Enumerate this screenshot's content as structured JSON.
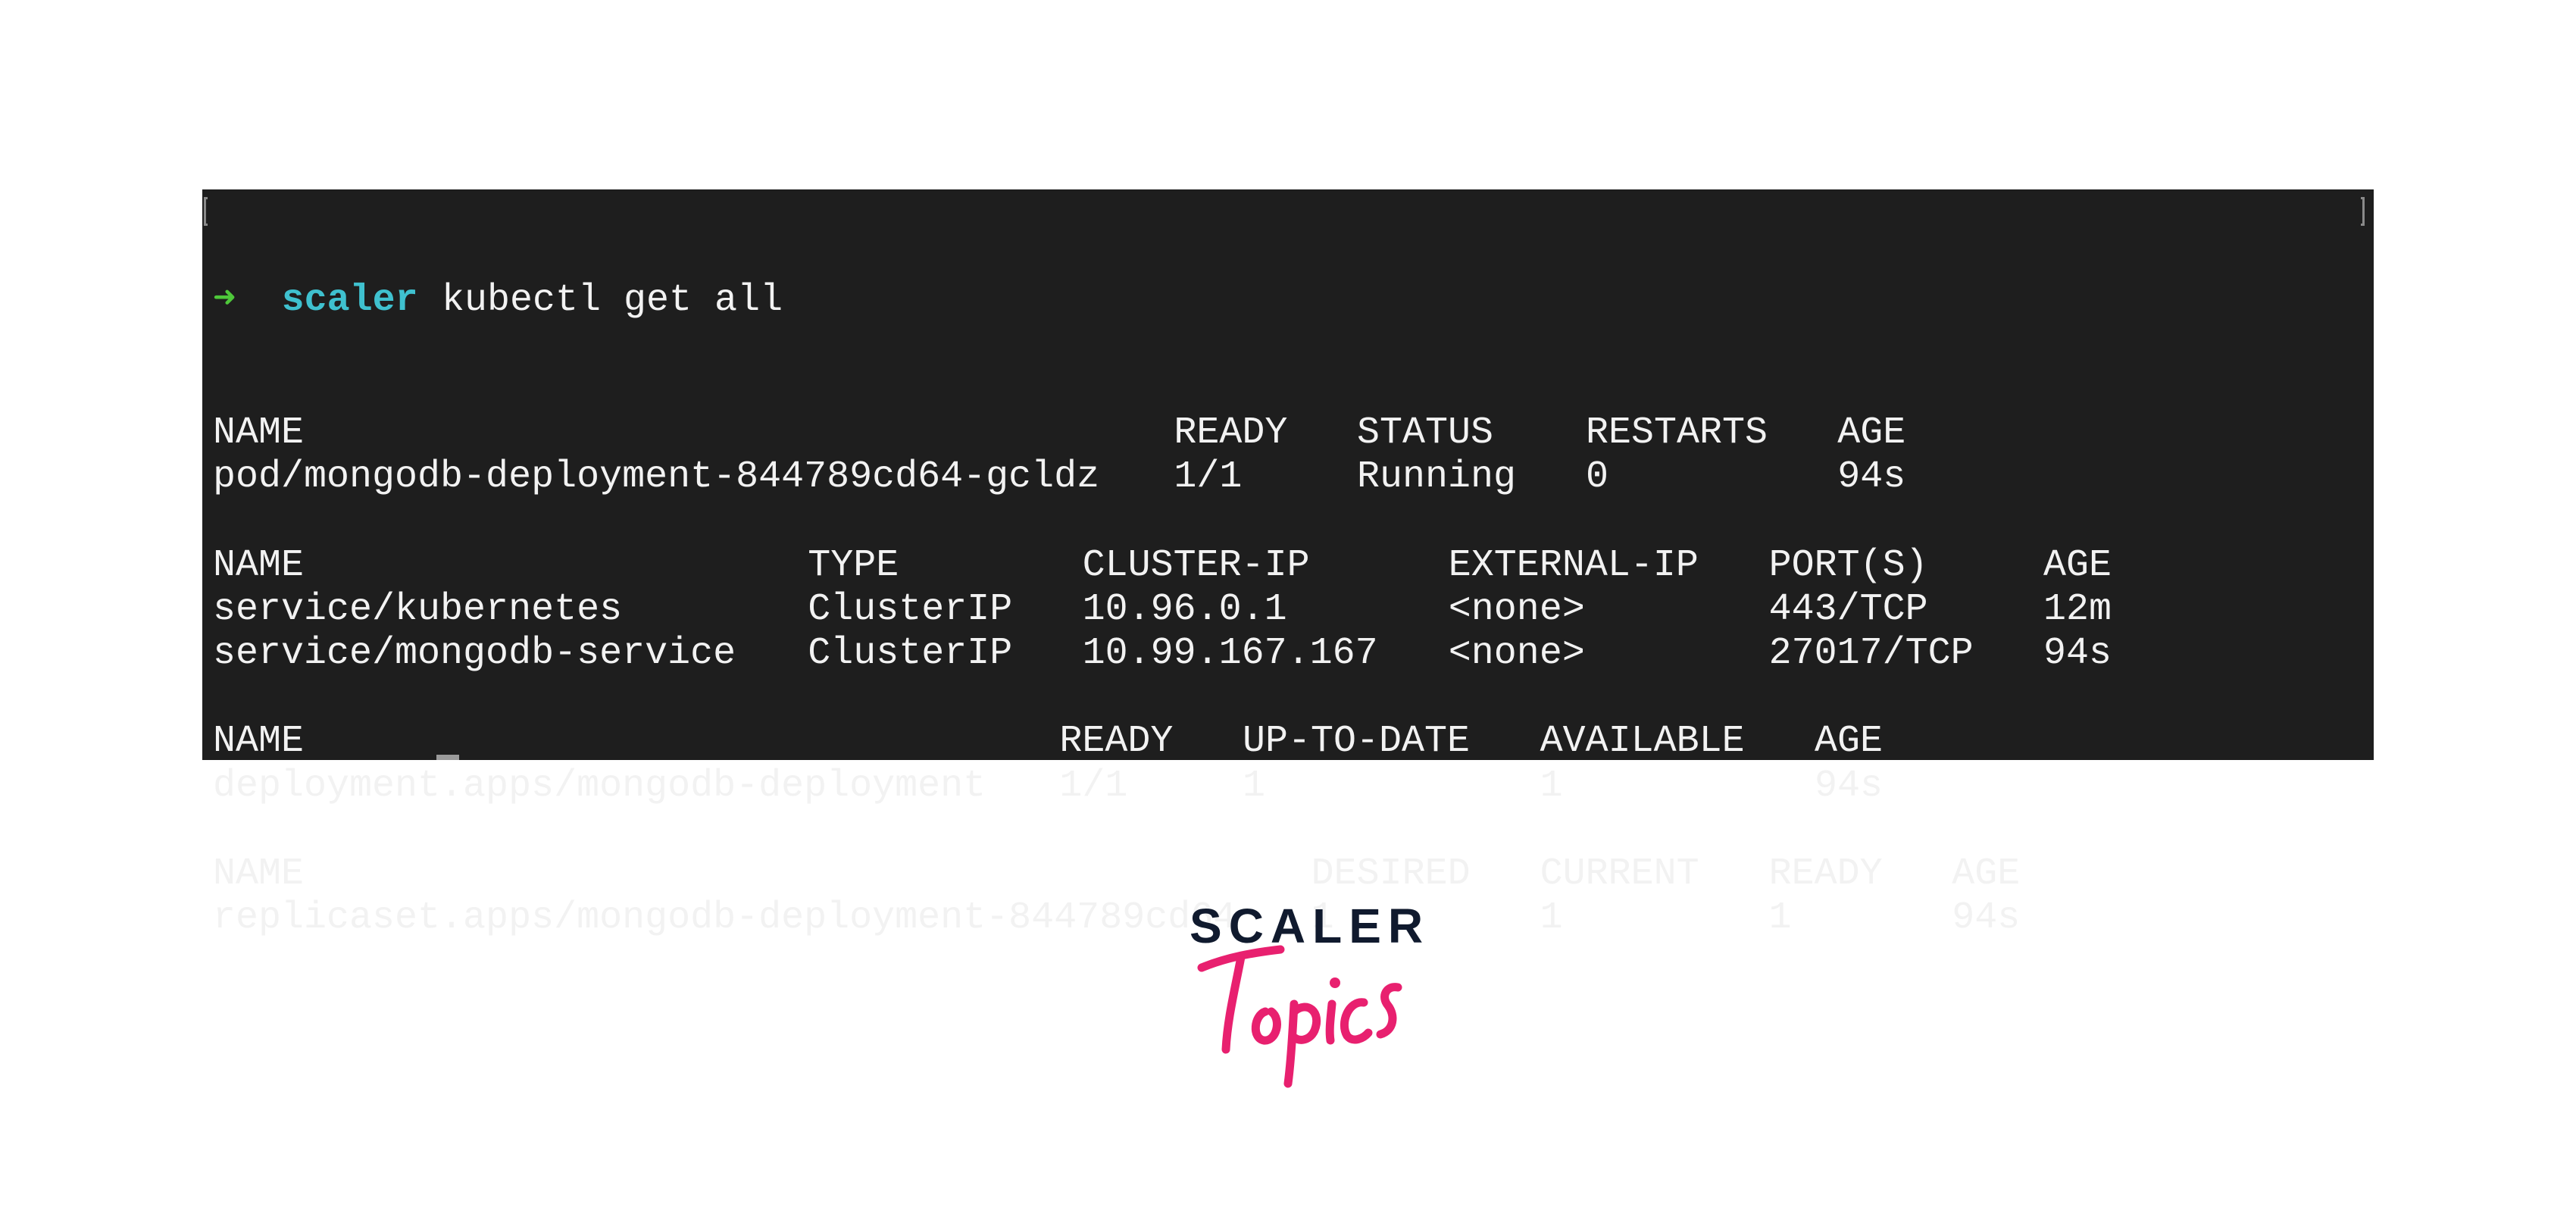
{
  "terminal": {
    "prompt": {
      "arrow": "➜",
      "directory": "scaler",
      "command": "kubectl get all"
    },
    "sections": [
      {
        "name": "pods",
        "columns": [
          {
            "label": "NAME",
            "col": 0
          },
          {
            "label": "READY",
            "col": 42
          },
          {
            "label": "STATUS",
            "col": 50
          },
          {
            "label": "RESTARTS",
            "col": 60
          },
          {
            "label": "AGE",
            "col": 71
          }
        ],
        "rows": [
          [
            "pod/mongodb-deployment-844789cd64-gcldz",
            "1/1",
            "Running",
            "0",
            "94s"
          ]
        ]
      },
      {
        "name": "services",
        "columns": [
          {
            "label": "NAME",
            "col": 0
          },
          {
            "label": "TYPE",
            "col": 26
          },
          {
            "label": "CLUSTER-IP",
            "col": 38
          },
          {
            "label": "EXTERNAL-IP",
            "col": 54
          },
          {
            "label": "PORT(S)",
            "col": 68
          },
          {
            "label": "AGE",
            "col": 80
          }
        ],
        "rows": [
          [
            "service/kubernetes",
            "ClusterIP",
            "10.96.0.1",
            "<none>",
            "443/TCP",
            "12m"
          ],
          [
            "service/mongodb-service",
            "ClusterIP",
            "10.99.167.167",
            "<none>",
            "27017/TCP",
            "94s"
          ]
        ]
      },
      {
        "name": "deployments",
        "columns": [
          {
            "label": "NAME",
            "col": 0
          },
          {
            "label": "READY",
            "col": 37
          },
          {
            "label": "UP-TO-DATE",
            "col": 45
          },
          {
            "label": "AVAILABLE",
            "col": 58
          },
          {
            "label": "AGE",
            "col": 70
          }
        ],
        "rows": [
          [
            "deployment.apps/mongodb-deployment",
            "1/1",
            "1",
            "1",
            "94s"
          ]
        ]
      },
      {
        "name": "replicasets",
        "columns": [
          {
            "label": "NAME",
            "col": 0
          },
          {
            "label": "DESIRED",
            "col": 48
          },
          {
            "label": "CURRENT",
            "col": 58
          },
          {
            "label": "READY",
            "col": 68
          },
          {
            "label": "AGE",
            "col": 76
          }
        ],
        "rows": [
          [
            "replicaset.apps/mongodb-deployment-844789cd64",
            "1",
            "1",
            "1",
            "94s"
          ]
        ]
      }
    ],
    "colors": {
      "background": "#1e1e1e",
      "text": "#f2f2f2",
      "prompt_arrow": "#4ec83a",
      "prompt_directory": "#3fc1cf"
    }
  },
  "logo": {
    "brand": "SCALER",
    "sub": "Topics",
    "colors": {
      "brand": "#101a2e",
      "sub": "#e8206f"
    }
  }
}
